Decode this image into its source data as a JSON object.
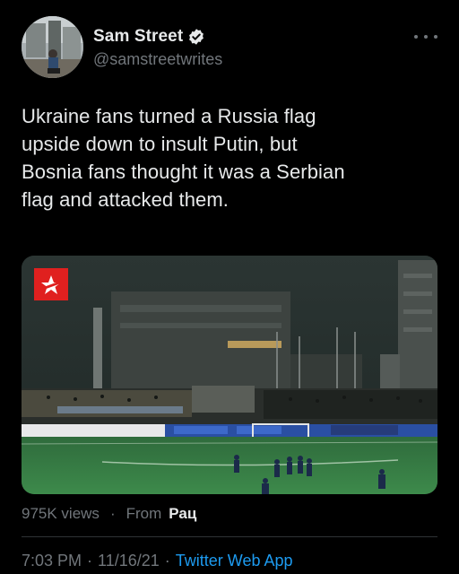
{
  "author": {
    "name": "Sam Street",
    "handle": "@samstreetwrites",
    "verified": true
  },
  "tweet": {
    "text": "Ukraine fans turned a Russia flag\nupside down to insult Putin, but\nBosnia fans thought it was a Serbian\nflag and attacked them."
  },
  "media": {
    "type": "video",
    "description_icon": "broadcaster-star-logo"
  },
  "stats": {
    "views": "975K views",
    "dot": "·",
    "from_label": "From",
    "source": "Рац"
  },
  "meta": {
    "time": "7:03 PM",
    "dot1": "·",
    "date": "11/16/21",
    "dot2": "·",
    "app": "Twitter Web App"
  },
  "colors": {
    "background": "#000000",
    "text": "#e7e9ea",
    "secondary": "#71767b",
    "link": "#1d9bf0",
    "verified": "#e7e9ea",
    "logo_red": "#e0201f"
  }
}
